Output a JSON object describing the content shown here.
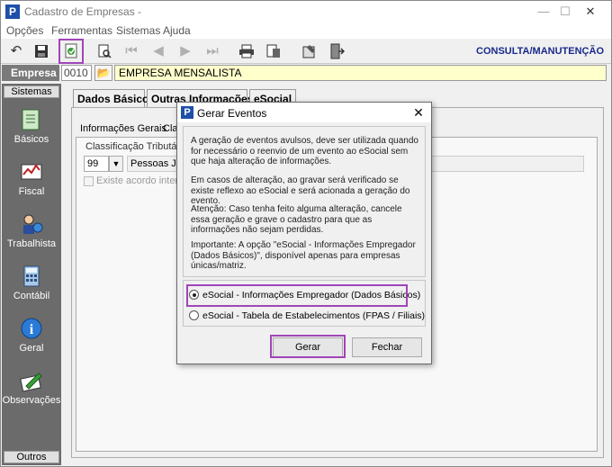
{
  "window": {
    "title": "Cadastro de Empresas -",
    "min_glyph": "—",
    "max_glyph": "☐",
    "close_glyph": "✕"
  },
  "menu": {
    "items": [
      "Opções",
      "Ferramentas",
      "Sistemas",
      "Ajuda"
    ]
  },
  "toolbar": {
    "mode_label": "CONSULTA/MANUTENÇÃO"
  },
  "empresa": {
    "label": "Empresa",
    "code": "0010",
    "name": "EMPRESA MENSALISTA"
  },
  "sidebar": {
    "header": "Sistemas",
    "footer": "Outros",
    "items": [
      {
        "label": "Básicos",
        "icon": "notes-icon"
      },
      {
        "label": "Fiscal",
        "icon": "calculator-chart-icon"
      },
      {
        "label": "Trabalhista",
        "icon": "person-globe-icon"
      },
      {
        "label": "Contábil",
        "icon": "calculator-icon"
      },
      {
        "label": "Geral",
        "icon": "info-icon"
      },
      {
        "label": "Observações",
        "icon": "pen-paper-icon"
      }
    ]
  },
  "tabs": [
    "Dados Básicos",
    "Outras Informações",
    "eSocial"
  ],
  "subtabs": [
    "Informações Gerais",
    "Clas"
  ],
  "form": {
    "group_label": "Classificação Tributária",
    "classif_code": "99",
    "classif_desc": "Pessoas Jurí",
    "checkbox_label": "Existe acordo interna"
  },
  "dialog": {
    "title": "Gerar Eventos",
    "p1": "A geração de eventos avulsos, deve ser utilizada quando for necessário o reenvio de um evento ao eSocial sem que haja alteração de informações.",
    "p2": "Em casos de alteração, ao gravar será verificado se existe reflexo ao eSocial e será acionada a geração do evento.",
    "p3": "Atenção: Caso tenha feito alguma alteração, cancele essa geração e grave o cadastro para que as informações não sejam perdidas.",
    "p4": "Importante: A opção \"eSocial - Informações Empregador (Dados Básicos)\", disponível apenas para empresas únicas/matriz.",
    "option1": "eSocial - Informações Empregador (Dados Básicos)",
    "option2": "eSocial - Tabela de Estabelecimentos (FPAS / Filiais)",
    "gerar": "Gerar",
    "fechar": "Fechar"
  },
  "colors": {
    "highlight": "#a045b8",
    "mode_label": "#1a2a8c",
    "empresa_name_bg": "#ffffcc",
    "sidebar_bg": "#6b6b6b"
  }
}
